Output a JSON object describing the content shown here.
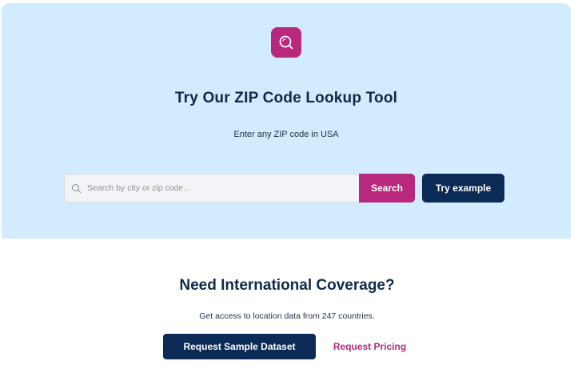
{
  "colors": {
    "hero_background": "#d2ebfd",
    "accent_magenta": "#b8287d",
    "navy": "#0b2a55"
  },
  "hero": {
    "icon": "search-icon",
    "title": "Try Our ZIP Code Lookup Tool",
    "subtitle": "Enter any ZIP code in USA"
  },
  "search": {
    "icon": "search-icon",
    "value": "",
    "placeholder": "Search by city or zip code...",
    "button_label": "Search",
    "example_label": "Try example"
  },
  "international": {
    "title": "Need International Coverage?",
    "subtitle": "Get access to location data from 247 countries.",
    "sample_button_label": "Request Sample Dataset",
    "pricing_link_label": "Request Pricing"
  }
}
